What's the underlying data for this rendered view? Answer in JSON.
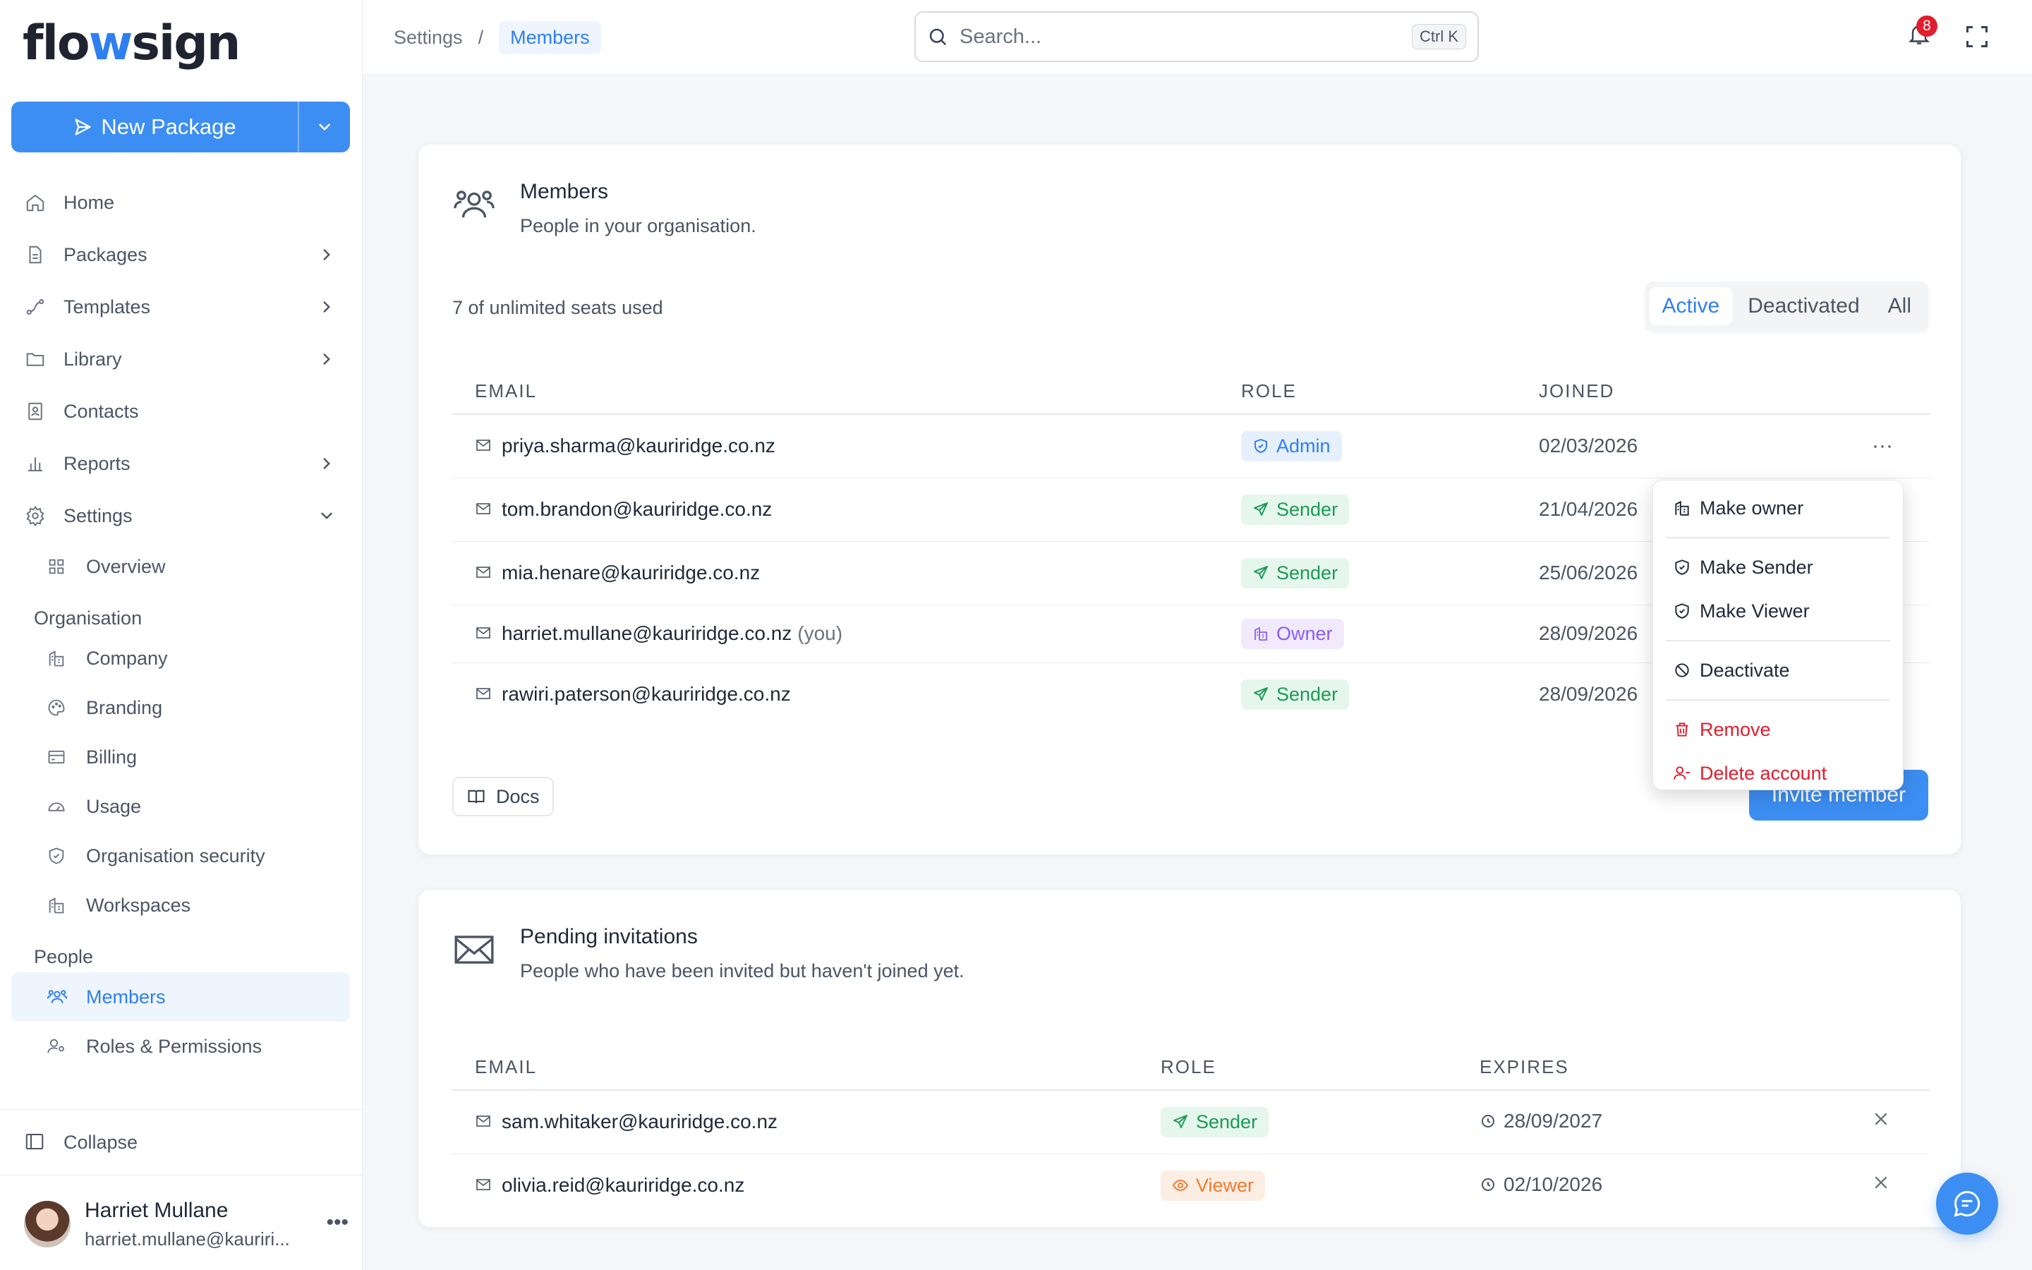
{
  "brand": {
    "logo_text_1": "flo",
    "logo_text_2": "w",
    "logo_text_3": "sign"
  },
  "sidebar": {
    "new_package_label": "New Package",
    "nav": [
      {
        "label": "Home"
      },
      {
        "label": "Packages"
      },
      {
        "label": "Templates"
      },
      {
        "label": "Library"
      },
      {
        "label": "Contacts"
      },
      {
        "label": "Reports"
      },
      {
        "label": "Settings"
      }
    ],
    "settings_sub": {
      "overview": "Overview"
    },
    "organisation_section": "Organisation",
    "organisation_items": [
      "Company",
      "Branding",
      "Billing",
      "Usage",
      "Organisation security",
      "Workspaces"
    ],
    "people_section": "People",
    "people_items": [
      "Members",
      "Roles & Permissions"
    ],
    "collapse_label": "Collapse",
    "user": {
      "name": "Harriet Mullane",
      "email": "harriet.mullane@kauriri..."
    }
  },
  "topbar": {
    "breadcrumb": [
      "Settings",
      "Members"
    ],
    "breadcrumb_sep": "/",
    "search_placeholder": "Search...",
    "search_shortcut": "Ctrl K",
    "notification_count": "8"
  },
  "members_card": {
    "title": "Members",
    "subtitle": "People in your organisation.",
    "seats": "7 of unlimited seats used",
    "filters": [
      "Active",
      "Deactivated",
      "All"
    ],
    "active_filter": "Active",
    "columns": [
      "EMAIL",
      "ROLE",
      "JOINED"
    ],
    "rows": [
      {
        "email": "priya.sharma@kauriridge.co.nz",
        "you": "",
        "role": "Admin",
        "joined": "02/03/2026"
      },
      {
        "email": "tom.brandon@kauriridge.co.nz",
        "you": "",
        "role": "Sender",
        "joined": "21/04/2026"
      },
      {
        "email": "mia.henare@kauriridge.co.nz",
        "you": "",
        "role": "Sender",
        "joined": "25/06/2026"
      },
      {
        "email": "harriet.mullane@kauriridge.co.nz",
        "you": "(you)",
        "role": "Owner",
        "joined": "28/09/2026"
      },
      {
        "email": "rawiri.paterson@kauriridge.co.nz",
        "you": "",
        "role": "Sender",
        "joined": "28/09/2026"
      }
    ],
    "row_menu_label": "···",
    "docs_label": "Docs",
    "invite_label": "Invite member"
  },
  "row_menu": {
    "items": [
      "Make owner",
      "Make Sender",
      "Make Viewer",
      "Deactivate",
      "Remove",
      "Delete account"
    ]
  },
  "pending_card": {
    "title": "Pending invitations",
    "subtitle": "People who have been invited but haven't joined yet.",
    "columns": [
      "EMAIL",
      "ROLE",
      "EXPIRES"
    ],
    "rows": [
      {
        "email": "sam.whitaker@kauriridge.co.nz",
        "role": "Sender",
        "expires": "28/09/2027"
      },
      {
        "email": "olivia.reid@kauriridge.co.nz",
        "role": "Viewer",
        "expires": "02/10/2026"
      }
    ]
  },
  "colors": {
    "accent": "#3d8ef2",
    "admin": "#2f7ff0",
    "sender": "#1d9a55",
    "owner": "#8b5cf6",
    "viewer": "#ef7b2f",
    "danger": "#e11d2e"
  }
}
